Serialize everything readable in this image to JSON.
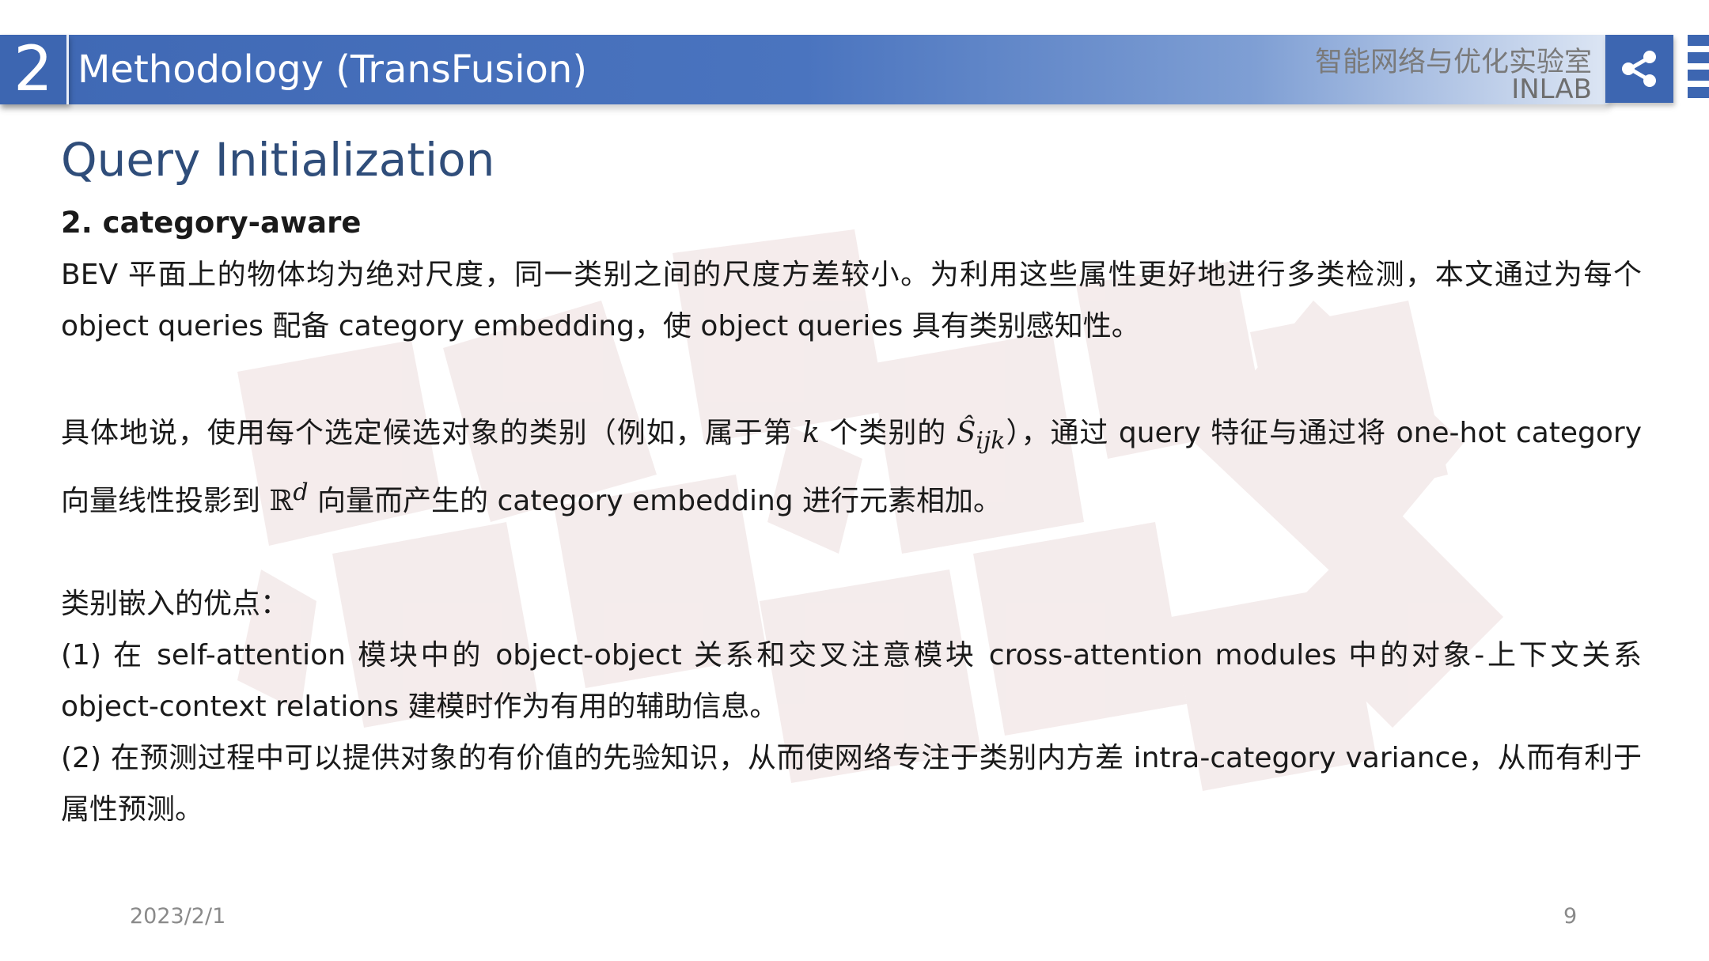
{
  "header": {
    "section_number": "2",
    "title": "Methodology (TransFusion)",
    "lab_name_cn": "智能网络与优化实验室",
    "lab_name_en": "INLAB",
    "share_icon": "share-icon"
  },
  "slide": {
    "heading": "Query Initialization",
    "subheading": "2. category-aware",
    "para1": "BEV 平面上的物体均为绝对尺度，同一类别之间的尺度方差较小。为利用这些属性更好地进行多类检测，本文通过为每个 object queries 配备 category embedding，使 object queries 具有类别感知性。",
    "para2_a": "具体地说，使用每个选定候选对象的类别（例如，属于第 ",
    "para2_k": "k",
    "para2_b": " 个类别的 ",
    "para2_s": "Ŝ",
    "para2_sub": "ijk",
    "para2_c": "），通过 query 特征与通过将 one-hot category 向量线性投影到 ",
    "para2_r": "ℝ",
    "para2_sup": "d",
    "para2_d": " 向量而产生的 category embedding 进行元素相加。",
    "advantages_title": "类别嵌入的优点：",
    "advantage1": "(1) 在 self-attention 模块中的 object-object 关系和交叉注意模块 cross-attention modules 中的对象-上下文关系 object-context relations 建模时作为有用的辅助信息。",
    "advantage2": "(2) 在预测过程中可以提供对象的有价值的先验知识，从而使网络专注于类别内方差 intra-category variance，从而有利于属性预测。"
  },
  "footer": {
    "date": "2023/2/1",
    "page_number": "9"
  },
  "colors": {
    "header_blue": "#3d66b1",
    "heading_navy": "#2f4d7a",
    "watermark": "#efe4e4"
  }
}
